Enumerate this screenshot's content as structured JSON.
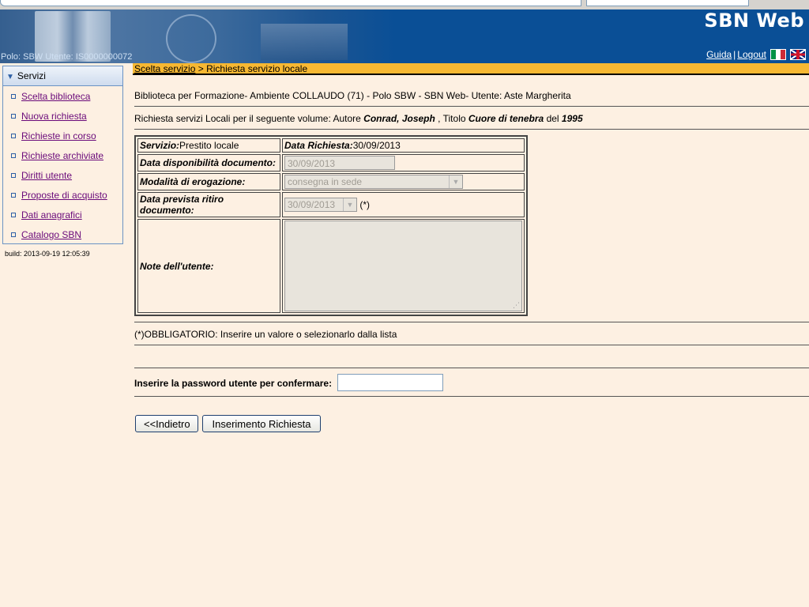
{
  "banner": {
    "title": "SBN Web",
    "polo_user": "Polo: SBW  Utente: IS0000000072",
    "help_link": "Guida",
    "separator": "|",
    "logout_link": "Logout"
  },
  "breadcrumb": {
    "parent": "Scelta servizio",
    "separator": " > ",
    "current": "Richiesta servizio locale"
  },
  "sidebar": {
    "header": "Servizi",
    "items": [
      {
        "label": "Scelta biblioteca"
      },
      {
        "label": "Nuova richiesta"
      },
      {
        "label": "Richieste in corso"
      },
      {
        "label": "Richieste archiviate"
      },
      {
        "label": "Diritti utente"
      },
      {
        "label": "Proposte di acquisto"
      },
      {
        "label": "Dati anagrafici"
      },
      {
        "label": "Catalogo SBN"
      }
    ],
    "build": "build: 2013-09-19 12:05:39"
  },
  "main": {
    "library_line": "Biblioteca per Formazione- Ambiente COLLAUDO (71) - Polo SBW - SBN Web- Utente: Aste Margherita",
    "request_prefix": "Richiesta servizi Locali per il seguente volume: Autore ",
    "author": "Conrad, Joseph",
    "title_prefix": " , Titolo ",
    "title": "Cuore di tenebra",
    "year_prefix": " del ",
    "year": "1995",
    "form": {
      "servizio_label": "Servizio:",
      "servizio_value": "Prestito locale",
      "data_richiesta_label": "Data Richiesta:",
      "data_richiesta_value": "30/09/2013",
      "disponibilita_label": "Data disponibilità documento:",
      "disponibilita_value": "30/09/2013",
      "modalita_label": "Modalità di erogazione:",
      "modalita_value": "consegna in sede",
      "ritiro_label": "Data prevista ritiro documento:",
      "ritiro_value": "30/09/2013",
      "ritiro_required": "(*)",
      "note_label": "Note dell'utente:"
    },
    "mandatory_note": "(*)OBBLIGATORIO: Inserire un valore o selezionarlo dalla lista",
    "password_label": "Inserire la password utente per confermare:",
    "back_button": "<<Indietro",
    "submit_button": "Inserimento Richiesta"
  }
}
